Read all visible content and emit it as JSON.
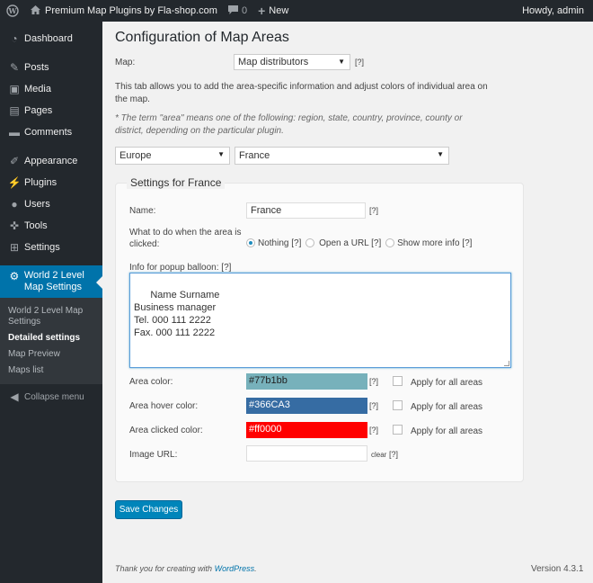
{
  "adminbar": {
    "wp_logo_icon": "wordpress-icon",
    "site_icon": "home-icon",
    "site_name": "Premium Map Plugins by Fla-shop.com",
    "comments_icon": "comment-bubble-icon",
    "comments_count": "0",
    "new_icon": "plus-icon",
    "new_label": "New",
    "howdy": "Howdy, admin"
  },
  "sidebar": {
    "items": [
      {
        "label": "Dashboard",
        "icon": "dashboard-icon"
      },
      {
        "label": "Posts",
        "icon": "pin-icon"
      },
      {
        "label": "Media",
        "icon": "media-icon"
      },
      {
        "label": "Pages",
        "icon": "pages-icon"
      },
      {
        "label": "Comments",
        "icon": "comment-icon"
      },
      {
        "label": "Appearance",
        "icon": "brush-icon"
      },
      {
        "label": "Plugins",
        "icon": "plug-icon"
      },
      {
        "label": "Users",
        "icon": "user-icon"
      },
      {
        "label": "Tools",
        "icon": "wrench-icon"
      },
      {
        "label": "Settings",
        "icon": "settings-icon"
      }
    ],
    "current": {
      "label": "World 2 Level Map Settings",
      "icon": "gear-icon"
    },
    "submenu": [
      "World 2 Level Map Settings",
      "Detailed settings",
      "Map Preview",
      "Maps list"
    ],
    "collapse": "Collapse menu"
  },
  "page": {
    "title": "Configuration of Map Areas",
    "map_label": "Map:",
    "map_value": "Map distributors",
    "help": "[?]",
    "intro": "This tab allows you to add the area-specific information and adjust colors of individual area on the map.",
    "note": "* The term \"area\" means one of the following: region, state, country, province, county or district, depending on the particular plugin.",
    "region_value": "Europe",
    "country_value": "France"
  },
  "settings": {
    "title": "Settings for France",
    "name_label": "Name:",
    "name_value": "France",
    "click_label": "What to do when the area is clicked:",
    "options": [
      "Nothing [?]",
      "Open a URL [?]",
      "Show more info [?]"
    ],
    "popup_label": "Info for popup balloon: [?]",
    "popup_value": "Name Surname\nBusiness manager\nTel. 000 111 2222\nFax. 000 111 2222",
    "area_color_label": "Area color:",
    "area_color": "#77b1bb",
    "hover_color_label": "Area hover color:",
    "hover_color": "#366CA3",
    "clicked_color_label": "Area clicked color:",
    "clicked_color": "#ff0000",
    "apply_all": "Apply for all areas",
    "image_label": "Image URL:",
    "clear": "clear"
  },
  "save_label": "Save Changes",
  "footer": {
    "thanks": "Thank you for creating with",
    "wp_link": "WordPress",
    "period": ".",
    "version": "Version 4.3.1"
  }
}
